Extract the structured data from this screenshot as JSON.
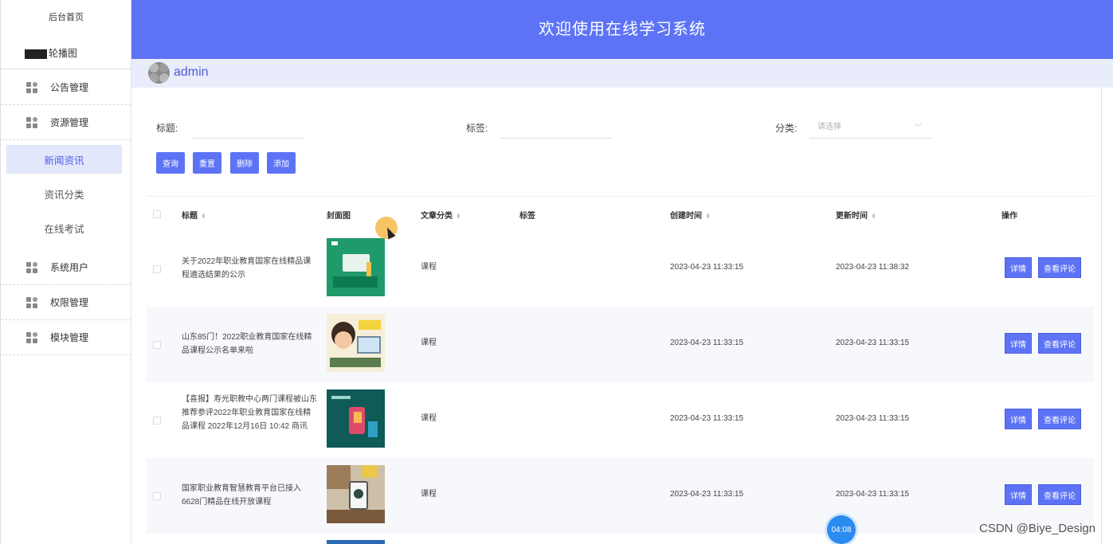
{
  "sidebar": {
    "home": "后台首页",
    "top_item": "轮播图",
    "groups": [
      {
        "label": "公告管理"
      },
      {
        "label": "资源管理"
      },
      {
        "label": "系统用户"
      },
      {
        "label": "权限管理"
      },
      {
        "label": "模块管理"
      }
    ],
    "subs": [
      {
        "label": "新闻资讯",
        "active": true
      },
      {
        "label": "资讯分类"
      },
      {
        "label": "在线考试"
      }
    ]
  },
  "header": {
    "title": "欢迎使用在线学习系统"
  },
  "user": {
    "name": "admin"
  },
  "filters": {
    "title_label": "标题:",
    "tag_label": "标签:",
    "category_label": "分类:",
    "category_placeholder": "请选择"
  },
  "actions": {
    "query": "查询",
    "reset": "重置",
    "delete": "删除",
    "add": "添加"
  },
  "table": {
    "headers": {
      "title": "标题",
      "cover": "封面图",
      "category": "文章分类",
      "tag": "标签",
      "created": "创建时间",
      "updated": "更新时间",
      "ops": "操作"
    },
    "rows": [
      {
        "title": "关于2022年职业教育国家在线精品课程遴选结果的公示",
        "category": "课程",
        "created": "2023-04-23 11:33:15",
        "updated": "2023-04-23 11:38:32",
        "detail": "详情",
        "comments": "查看评论"
      },
      {
        "title": "山东85门！2022职业教育国家在线精品课程公示名单来啦",
        "category": "课程",
        "created": "2023-04-23 11:33:15",
        "updated": "2023-04-23 11:33:15",
        "detail": "详情",
        "comments": "查看评论"
      },
      {
        "title": "【喜报】寿光职教中心两门课程被山东推荐参评2022年职业教育国家在线精品课程 2022年12月16日 10:42 商讯",
        "category": "课程",
        "created": "2023-04-23 11:33:15",
        "updated": "2023-04-23 11:33:15",
        "detail": "详情",
        "comments": "查看评论"
      },
      {
        "title": "国家职业教育智慧教育平台已接入6628门精品在线开放课程",
        "category": "课程",
        "created": "2023-04-23 11:33:15",
        "updated": "2023-04-23 11:33:15",
        "detail": "详情",
        "comments": "查看评论"
      }
    ]
  },
  "overlay": {
    "timer": "04:08",
    "watermark": "CSDN @Biye_Design"
  },
  "colors": {
    "primary": "#5d73f5",
    "active_bg": "#e3e7fb"
  }
}
